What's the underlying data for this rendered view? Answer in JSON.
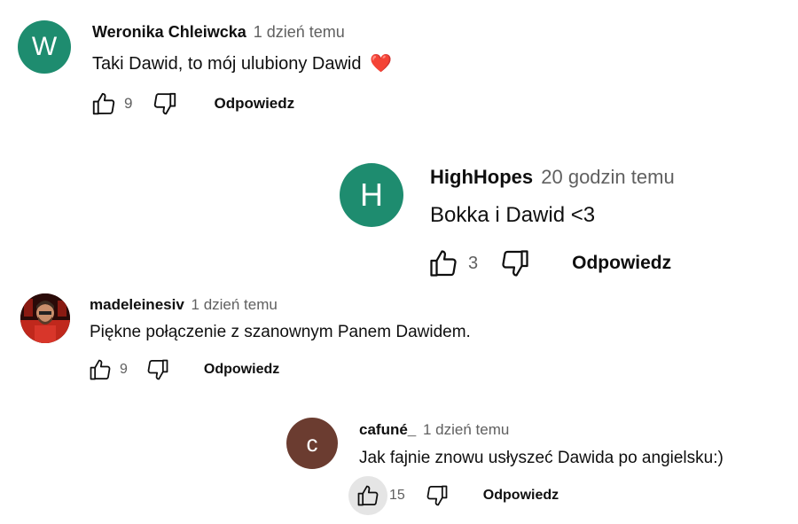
{
  "comments": [
    {
      "author": "Weronika Chleiwcka",
      "time": "1 dzień temu",
      "text": "Taki Dawid, to mój ulubiony Dawid",
      "emoji": "❤️",
      "avatar_letter": "W",
      "avatar_color": "#1e8c6f",
      "likes": "9",
      "reply_label": "Odpowiedz"
    },
    {
      "author": "HighHopes",
      "time": "20 godzin temu",
      "text": "Bokka i Dawid <3",
      "avatar_letter": "H",
      "avatar_color": "#1e8c6f",
      "likes": "3",
      "reply_label": "Odpowiedz"
    },
    {
      "author": "madeleinesiv",
      "time": "1 dzień temu",
      "text": "Piękne połączenie z szanownym Panem Dawidem.",
      "avatar_letter": "",
      "avatar_color": "#8a1a12",
      "likes": "9",
      "reply_label": "Odpowiedz"
    },
    {
      "author": "cafuné_",
      "time": "1 dzień temu",
      "text": "Jak fajnie znowu usłyszeć Dawida po angielsku:)",
      "avatar_letter": "c",
      "avatar_color": "#6b3c30",
      "likes": "15",
      "reply_label": "Odpowiedz"
    }
  ],
  "colors": {
    "text": "#0f0f0f",
    "muted": "#606060",
    "icon": "#0f0f0f"
  }
}
